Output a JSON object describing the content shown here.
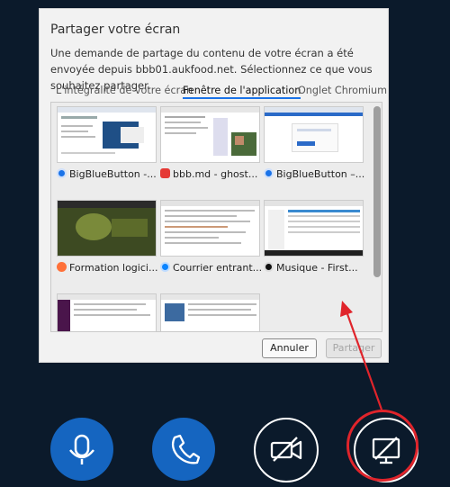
{
  "dialog": {
    "title": "Partager votre écran",
    "description": "Une demande de partage du contenu de votre écran a été envoyée depuis bbb01.aukfood.net. Sélectionnez ce que vous souhaitez partager.",
    "tabs": [
      "L'intégralité de votre écran",
      "Fenêtre de l'application",
      "Onglet Chromium"
    ],
    "active_tab": "Fenêtre de l'application",
    "windows": [
      {
        "label": "BigBlueButton -...",
        "icon": "chrome-icon"
      },
      {
        "label": "bbb.md - ghost...",
        "icon": "ghostwriter-icon"
      },
      {
        "label": "BigBlueButton –...",
        "icon": "chrome-icon"
      },
      {
        "label": "Formation logici...",
        "icon": "firefox-icon"
      },
      {
        "label": "Courrier entrant...",
        "icon": "thunderbird-icon"
      },
      {
        "label": "Musique - First...",
        "icon": "music-icon"
      }
    ],
    "cancel_label": "Annuler",
    "share_label": "Partager"
  },
  "colors": {
    "background": "#0b1a2b",
    "accent_blue": "#1565c0",
    "highlight_red": "#e0242b"
  },
  "controls": {
    "microphone": "microphone-icon",
    "phone": "phone-icon",
    "camera": "camera-off-icon",
    "screen": "screen-share-off-icon"
  }
}
